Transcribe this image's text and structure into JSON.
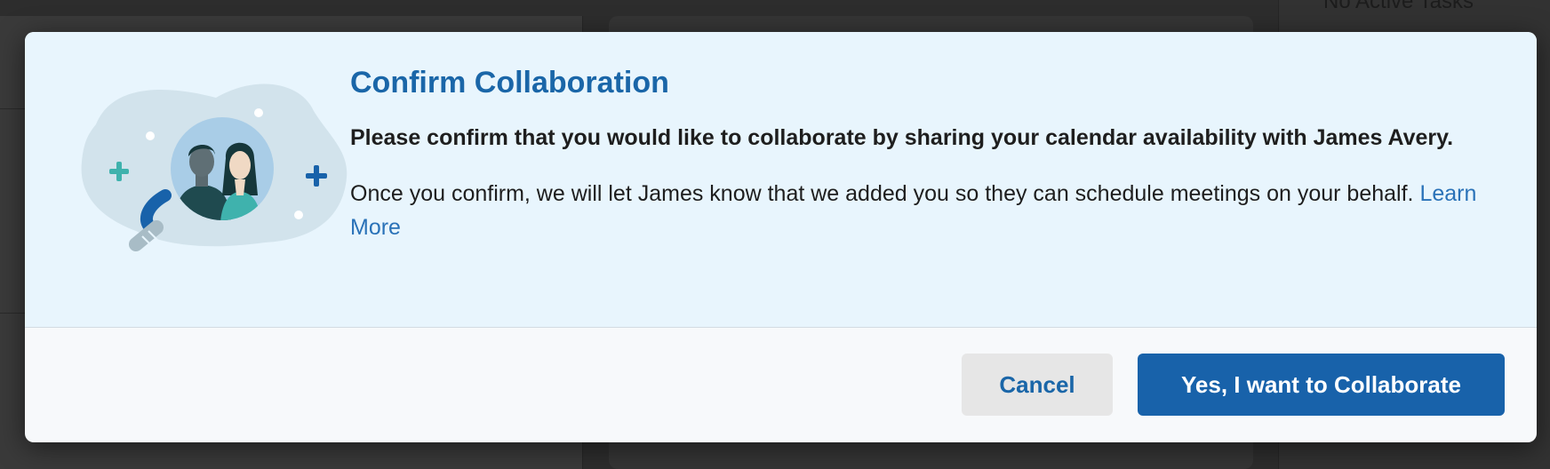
{
  "background": {
    "top_right_text": "No Active Tasks"
  },
  "modal": {
    "title": "Confirm Collaboration",
    "lead": "Please confirm that you would like to collaborate by sharing your calendar availability with James Avery.",
    "description": "Once you confirm, we will let James know that we added you so they can schedule meetings on your behalf.",
    "learn_more": "Learn More",
    "illustration_icon": "people-collaboration-icon",
    "buttons": {
      "cancel": "Cancel",
      "confirm": "Yes, I want to Collaborate"
    }
  },
  "colors": {
    "accent": "#1a66a8",
    "primary_button": "#1862aa",
    "header_band": "#e8f5fd"
  }
}
